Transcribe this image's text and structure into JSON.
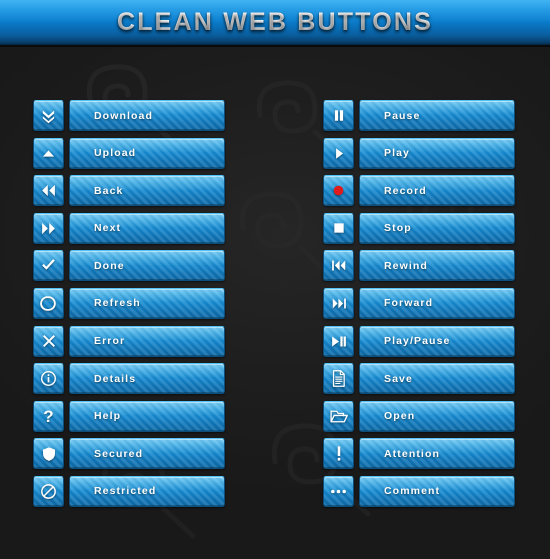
{
  "header": {
    "title": "CLEAN WEB BUTTONS"
  },
  "theme": {
    "page_background": "#1e1e1e",
    "header_blue_light": "#17a3ef",
    "header_blue_dark": "#05243d",
    "button_blue_light": "#39b4ee",
    "button_blue_dark": "#0f6ba8",
    "button_border": "#0a4f7d",
    "label_text_color": "#ffffff",
    "record_dot_color": "#e01b1b"
  },
  "columns": {
    "left": [
      {
        "label": "Download",
        "icon": "double-chevron-down-icon"
      },
      {
        "label": "Upload",
        "icon": "triangle-up-icon"
      },
      {
        "label": "Back",
        "icon": "double-arrow-left-icon"
      },
      {
        "label": "Next",
        "icon": "double-arrow-right-icon"
      },
      {
        "label": "Done",
        "icon": "check-icon"
      },
      {
        "label": "Refresh",
        "icon": "refresh-circle-icon"
      },
      {
        "label": "Error",
        "icon": "cross-icon"
      },
      {
        "label": "Details",
        "icon": "info-circle-icon"
      },
      {
        "label": "Help",
        "icon": "question-mark-icon"
      },
      {
        "label": "Secured",
        "icon": "shield-icon"
      },
      {
        "label": "Restricted",
        "icon": "no-entry-icon"
      }
    ],
    "right": [
      {
        "label": "Pause",
        "icon": "pause-icon"
      },
      {
        "label": "Play",
        "icon": "play-icon"
      },
      {
        "label": "Record",
        "icon": "record-dot-icon"
      },
      {
        "label": "Stop",
        "icon": "stop-square-icon"
      },
      {
        "label": "Rewind",
        "icon": "rewind-icon"
      },
      {
        "label": "Forward",
        "icon": "forward-icon"
      },
      {
        "label": "Play/Pause",
        "icon": "play-pause-icon"
      },
      {
        "label": "Save",
        "icon": "document-icon"
      },
      {
        "label": "Open",
        "icon": "folder-open-icon"
      },
      {
        "label": "Attention",
        "icon": "exclamation-icon"
      },
      {
        "label": "Comment",
        "icon": "ellipsis-icon"
      }
    ]
  }
}
